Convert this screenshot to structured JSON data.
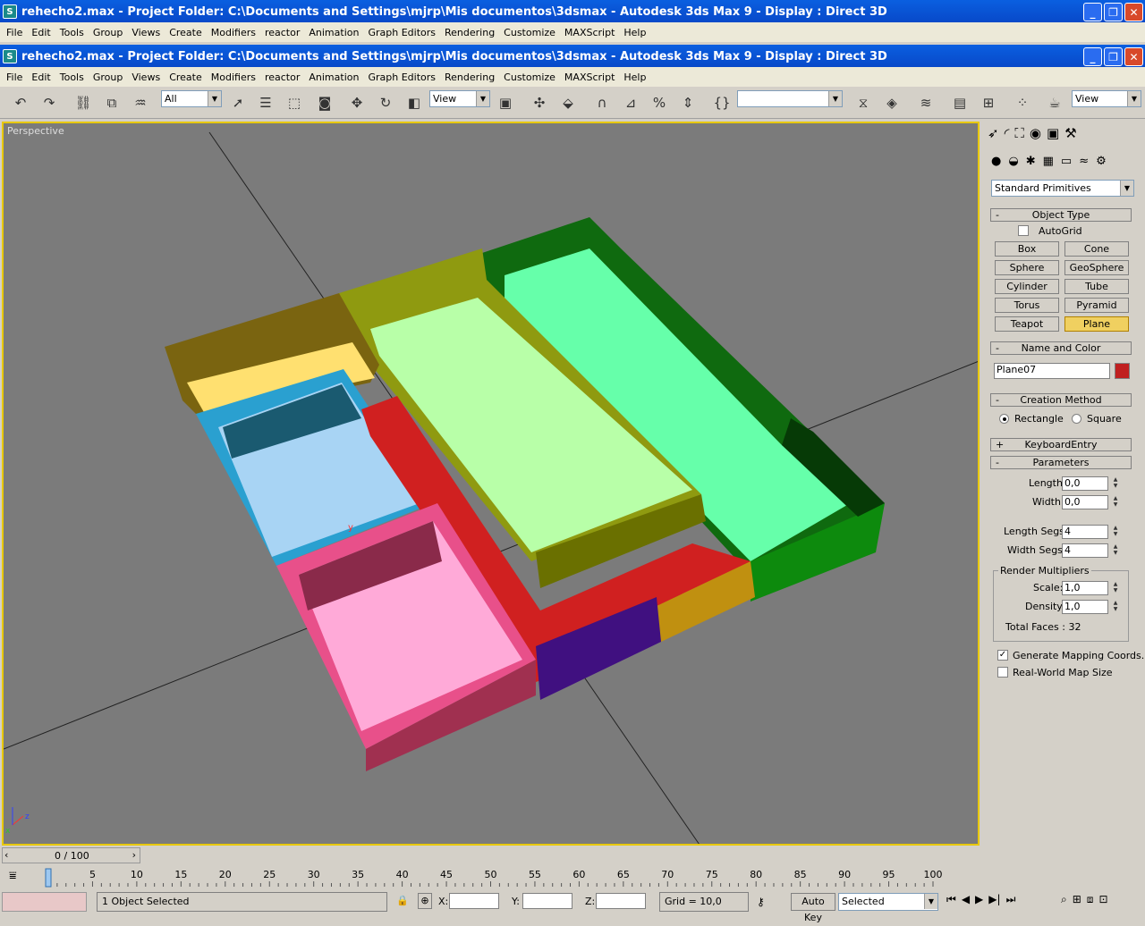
{
  "outer_window": {
    "title": "rehecho2.max     - Project Folder: C:\\Documents and Settings\\mjrp\\Mis documentos\\3dsmax      - Autodesk 3ds Max 9      - Display : Direct 3D"
  },
  "inner_window": {
    "title": "rehecho2.max     - Project Folder: C:\\Documents and Settings\\mjrp\\Mis documentos\\3dsmax      - Autodesk 3ds Max 9      - Display : Direct 3D"
  },
  "menu": [
    "File",
    "Edit",
    "Tools",
    "Group",
    "Views",
    "Create",
    "Modifiers",
    "reactor",
    "Animation",
    "Graph Editors",
    "Rendering",
    "Customize",
    "MAXScript",
    "Help"
  ],
  "toolbar": {
    "selection_filter": "All",
    "ref_coord": "View",
    "named_sel": "",
    "render_view": "View"
  },
  "viewport": {
    "label": "Perspective",
    "gizmo_x": "x",
    "gizmo_y": "y",
    "gizmo_z": "z"
  },
  "command_panel": {
    "category": "Standard Primitives",
    "object_type": {
      "title": "Object Type",
      "autogrid": "AutoGrid",
      "buttons": [
        "Box",
        "Cone",
        "Sphere",
        "GeoSphere",
        "Cylinder",
        "Tube",
        "Torus",
        "Pyramid",
        "Teapot",
        "Plane"
      ],
      "active": "Plane"
    },
    "name_color": {
      "title": "Name and Color",
      "name": "Plane07",
      "color": "#c02020"
    },
    "creation_method": {
      "title": "Creation Method",
      "opt1": "Rectangle",
      "opt2": "Square"
    },
    "keyboard_entry": "KeyboardEntry",
    "parameters": {
      "title": "Parameters",
      "length_label": "Length:",
      "length": "0,0",
      "width_label": "Width:",
      "width": "0,0",
      "length_segs_label": "Length Segs:",
      "length_segs": "4",
      "width_segs_label": "Width Segs:",
      "width_segs": "4",
      "render_mult": "Render Multipliers",
      "scale_label": "Scale:",
      "scale": "1,0",
      "density_label": "Density:",
      "density": "1,0",
      "total_faces": "Total Faces : 32",
      "gen_mapping": "Generate Mapping Coords.",
      "real_world": "Real-World Map Size"
    }
  },
  "timeline": {
    "frame": "0 / 100",
    "ticks": [
      "0",
      "5",
      "10",
      "15",
      "20",
      "25",
      "30",
      "35",
      "40",
      "45",
      "50",
      "55",
      "60",
      "65",
      "70",
      "75",
      "80",
      "85",
      "90",
      "95",
      "100"
    ]
  },
  "status": {
    "selected": "1 Object Selected",
    "x_label": "X:",
    "y_label": "Y:",
    "z_label": "Z:",
    "grid": "Grid = 10,0",
    "auto_key": "Auto Key",
    "key_filter": "Selected"
  }
}
